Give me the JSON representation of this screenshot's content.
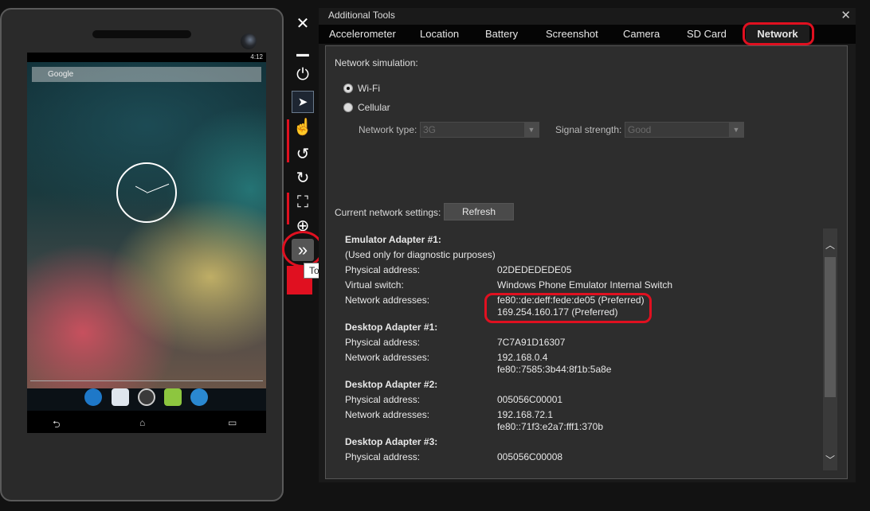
{
  "phone": {
    "status_time": "4:12",
    "search_placeholder": "Google",
    "nav": {
      "back": "⮌",
      "home": "⌂",
      "recents": "▭"
    }
  },
  "toolbar": {
    "close": "✕",
    "minimize": "▁",
    "power": "⏻",
    "pointer": "➤",
    "touch": "☝",
    "rotate_left": "↺",
    "rotate_right": "↻",
    "fit_screen": "⛶",
    "zoom": "⊕",
    "tools": "»",
    "tooltip": "Tools"
  },
  "panel": {
    "title": "Additional Tools",
    "close": "✕",
    "tabs": [
      "Accelerometer",
      "Location",
      "Battery",
      "Screenshot",
      "Camera",
      "SD Card",
      "Network"
    ],
    "active_tab": "Network"
  },
  "network": {
    "simulation_label": "Network simulation:",
    "wifi": "Wi-Fi",
    "cellular": "Cellular",
    "network_type_label": "Network type:",
    "network_type_value": "3G",
    "signal_strength_label": "Signal strength:",
    "signal_strength_value": "Good",
    "current_settings_label": "Current network settings:",
    "refresh": "Refresh"
  },
  "adapters": {
    "emu_title": "Emulator Adapter #1:",
    "emu_note": "(Used only for diagnostic purposes)",
    "emu_phys_label": "Physical address:",
    "emu_phys": "02DEDEDEDE05",
    "emu_switch_label": "Virtual switch:",
    "emu_switch": "Windows Phone Emulator Internal Switch",
    "emu_net_label": "Network addresses:",
    "emu_net1": "fe80::de:deff:fede:de05 (Preferred)",
    "emu_net2": "169.254.160.177 (Preferred)",
    "d1_title": "Desktop Adapter #1:",
    "d1_phys_label": "Physical address:",
    "d1_phys": "7C7A91D16307",
    "d1_net_label": "Network addresses:",
    "d1_net1": "192.168.0.4",
    "d1_net2": "fe80::7585:3b44:8f1b:5a8e",
    "d2_title": "Desktop Adapter #2:",
    "d2_phys_label": "Physical address:",
    "d2_phys": "005056C00001",
    "d2_net_label": "Network addresses:",
    "d2_net1": "192.168.72.1",
    "d2_net2": "fe80::71f3:e2a7:fff1:370b",
    "d3_title": "Desktop Adapter #3:",
    "d3_phys_label": "Physical address:",
    "d3_phys": "005056C00008"
  },
  "colors": {
    "highlight": "#e01020",
    "panel_bg": "#1a1a1a",
    "content_bg": "#2d2d2d"
  }
}
